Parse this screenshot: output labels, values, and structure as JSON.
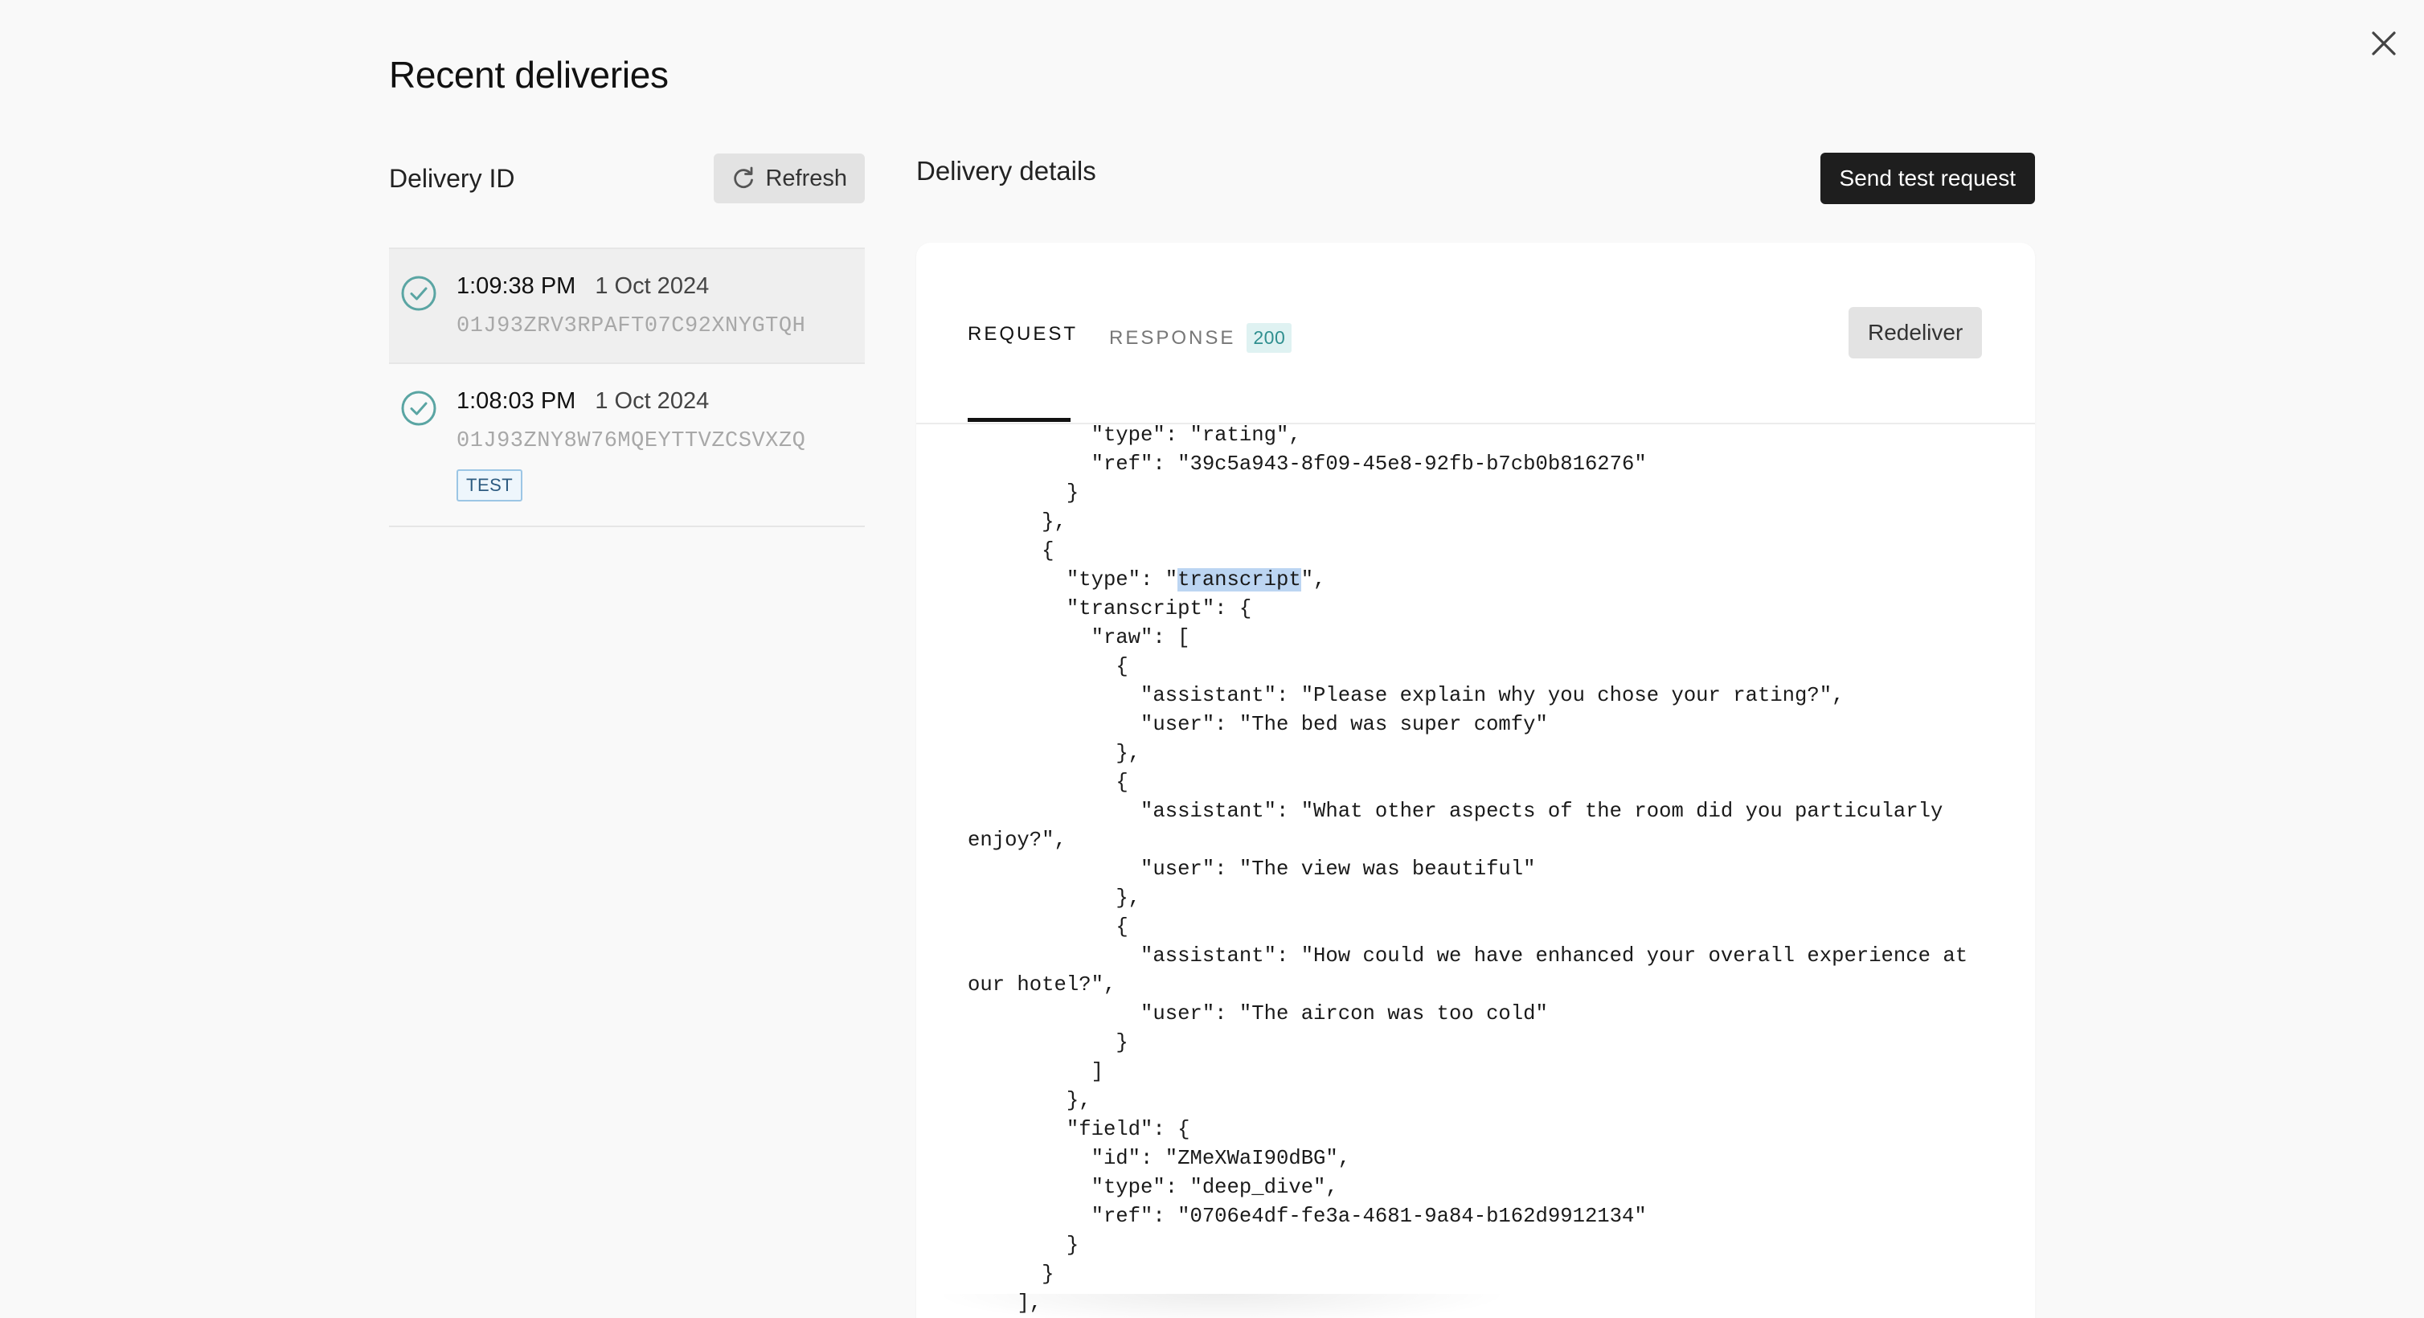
{
  "modal": {
    "title": "Recent deliveries",
    "close_icon": "close-icon"
  },
  "left": {
    "header_label": "Delivery ID",
    "refresh_label": "Refresh",
    "refresh_icon": "refresh-icon",
    "deliveries": [
      {
        "time": "1:09:38 PM",
        "date": "1 Oct 2024",
        "id": "01J93ZRV3RPAFT07C92XNYGTQH",
        "status_icon": "check-circle-icon",
        "selected": true,
        "badge": ""
      },
      {
        "time": "1:08:03 PM",
        "date": "1 Oct 2024",
        "id": "01J93ZNY8W76MQEYTTVZCSVXZQ",
        "status_icon": "check-circle-icon",
        "selected": false,
        "badge": "TEST"
      }
    ]
  },
  "right": {
    "header_label": "Delivery details",
    "send_test_label": "Send test request",
    "tabs": [
      {
        "label": "REQUEST",
        "active": true
      },
      {
        "label": "RESPONSE",
        "active": false,
        "badge": "200"
      }
    ],
    "redeliver_label": "Redeliver",
    "code": {
      "before_highlight": "          \"type\": \"rating\",\n          \"ref\": \"39c5a943-8f09-45e8-92fb-b7cb0b816276\"\n        }\n      },\n      {\n        \"type\": \"",
      "highlight": "transcript",
      "after_highlight": "\",\n        \"transcript\": {\n          \"raw\": [\n            {\n              \"assistant\": \"Please explain why you chose your rating?\",\n              \"user\": \"The bed was super comfy\"\n            },\n            {\n              \"assistant\": \"What other aspects of the room did you particularly enjoy?\",\n              \"user\": \"The view was beautiful\"\n            },\n            {\n              \"assistant\": \"How could we have enhanced your overall experience at our hotel?\",\n              \"user\": \"The aircon was too cold\"\n            }\n          ]\n        },\n        \"field\": {\n          \"id\": \"ZMeXWaI90dBG\",\n          \"type\": \"deep_dive\",\n          \"ref\": \"0706e4df-fe3a-4681-9a84-b162d9912134\"\n        }\n      }\n    ],"
    }
  },
  "colors": {
    "check_icon": "#5aa5a3",
    "primary_button": "#1e1e1e",
    "status_badge_bg": "#dff2f2",
    "status_badge_text": "#2f8f8f",
    "highlight": "#bcd5f2",
    "test_badge_border": "#9cc6e5"
  }
}
